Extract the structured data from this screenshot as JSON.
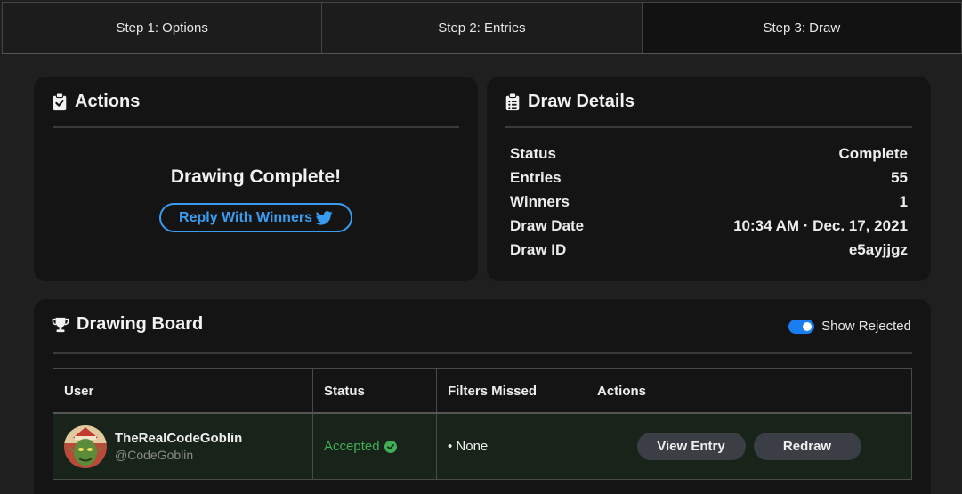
{
  "steps": [
    "Step 1: Options",
    "Step 2: Entries",
    "Step 3: Draw"
  ],
  "actions": {
    "title": "Actions",
    "complete_text": "Drawing Complete!",
    "reply_label": "Reply With Winners"
  },
  "details": {
    "title": "Draw Details",
    "rows": [
      {
        "label": "Status",
        "value": "Complete"
      },
      {
        "label": "Entries",
        "value": "55"
      },
      {
        "label": "Winners",
        "value": "1"
      },
      {
        "label": "Draw Date",
        "value": "10:34 AM · Dec. 17, 2021"
      },
      {
        "label": "Draw ID",
        "value": "e5ayjjgz"
      }
    ]
  },
  "board": {
    "title": "Drawing Board",
    "toggle_label": "Show Rejected",
    "toggle_on": true,
    "columns": [
      "User",
      "Status",
      "Filters Missed",
      "Actions"
    ],
    "rows": [
      {
        "name": "TheRealCodeGoblin",
        "handle": "@CodeGoblin",
        "status": "Accepted",
        "filters": "• None",
        "view_label": "View Entry",
        "redraw_label": "Redraw"
      }
    ]
  },
  "colors": {
    "accent": "#3a9cf0",
    "accepted": "#3fae55",
    "toggle": "#1a7df0"
  },
  "icons": [
    "clipboard-check-icon",
    "clipboard-list-icon",
    "twitter-icon",
    "trophy-icon",
    "check-circle-icon"
  ]
}
